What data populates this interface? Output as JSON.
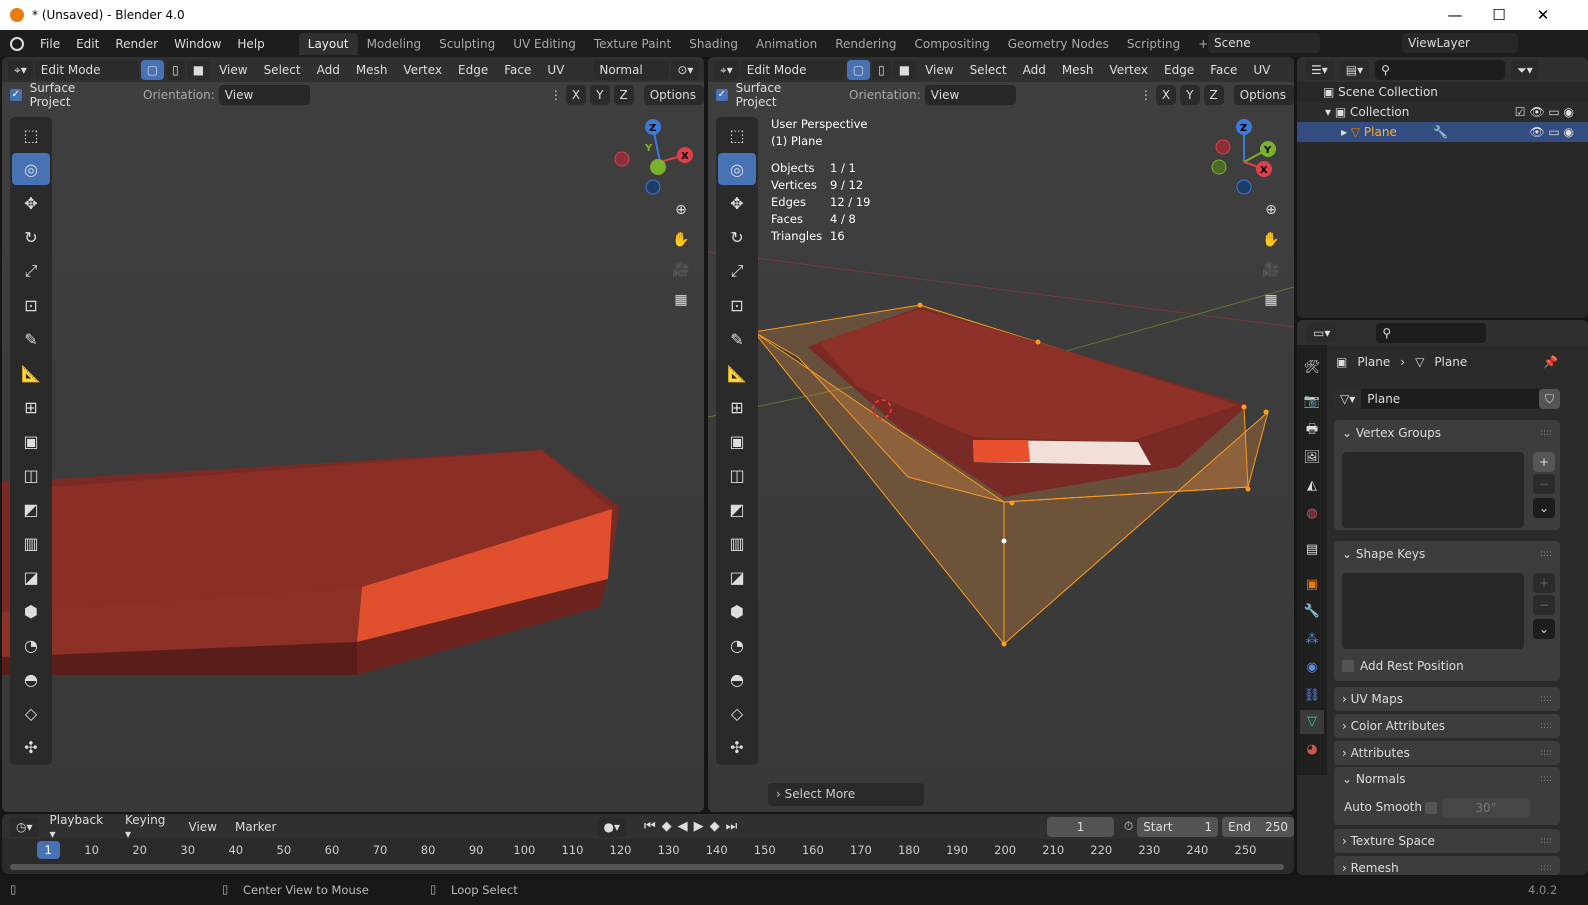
{
  "window": {
    "title": "* (Unsaved) - Blender 4.0",
    "minimize": "—",
    "maximize": "☐",
    "close": "✕"
  },
  "menu": [
    "File",
    "Edit",
    "Render",
    "Window",
    "Help"
  ],
  "workspaces": [
    "Layout",
    "Modeling",
    "Sculpting",
    "UV Editing",
    "Texture Paint",
    "Shading",
    "Animation",
    "Rendering",
    "Compositing",
    "Geometry Nodes",
    "Scripting",
    "+"
  ],
  "scene": "Scene",
  "view_layer": "ViewLayer",
  "viewport": {
    "mode": "Edit Mode",
    "menus": [
      "View",
      "Select",
      "Add",
      "Mesh",
      "Vertex",
      "Edge",
      "Face",
      "UV"
    ],
    "transform_orientation": "Normal",
    "surface_project": "Surface Project",
    "orientation_label": "Orientation:",
    "orientation_value": "View",
    "axes": [
      "X",
      "Y",
      "Z"
    ],
    "options": "Options"
  },
  "overlay": {
    "perspective": "User Perspective",
    "object": "(1) Plane",
    "stats": [
      {
        "k": "Objects",
        "v": "1 / 1"
      },
      {
        "k": "Vertices",
        "v": "9 / 12"
      },
      {
        "k": "Edges",
        "v": "12 / 19"
      },
      {
        "k": "Faces",
        "v": "4 / 8"
      },
      {
        "k": "Triangles",
        "v": "16"
      }
    ]
  },
  "last_operator": "Select More",
  "gizmo": {
    "x": "X",
    "y": "Y",
    "z": "Z"
  },
  "outliner": {
    "root": "Scene Collection",
    "collection": "Collection",
    "object": "Plane"
  },
  "properties": {
    "breadcrumb": [
      "Plane",
      "Plane"
    ],
    "data_name": "Plane",
    "panels": {
      "vertex_groups": "Vertex Groups",
      "shape_keys": "Shape Keys",
      "add_rest_position": "Add Rest Position",
      "uv_maps": "UV Maps",
      "color_attributes": "Color Attributes",
      "attributes": "Attributes",
      "normals": "Normals",
      "auto_smooth": "Auto Smooth",
      "auto_smooth_angle": "30°",
      "texture_space": "Texture Space",
      "remesh": "Remesh"
    }
  },
  "timeline": {
    "menus": [
      "Playback",
      "Keying",
      "View",
      "Marker"
    ],
    "current_frame": "1",
    "start_label": "Start",
    "start": "1",
    "end_label": "End",
    "end": "250",
    "ticks": [
      "1",
      "10",
      "20",
      "30",
      "40",
      "50",
      "60",
      "70",
      "80",
      "90",
      "100",
      "110",
      "120",
      "130",
      "140",
      "150",
      "160",
      "170",
      "180",
      "190",
      "200",
      "210",
      "220",
      "230",
      "240",
      "250"
    ]
  },
  "status": {
    "center_view": "Center View to Mouse",
    "loop_select": "Loop Select",
    "version": "4.0.2"
  },
  "colors": {
    "accent": "#4772b3",
    "mesh": "#b8402c",
    "selection": "#ff9c1a",
    "x_axis": "#e0404a",
    "y_axis": "#7bb22c",
    "z_axis": "#3a7ad8"
  }
}
